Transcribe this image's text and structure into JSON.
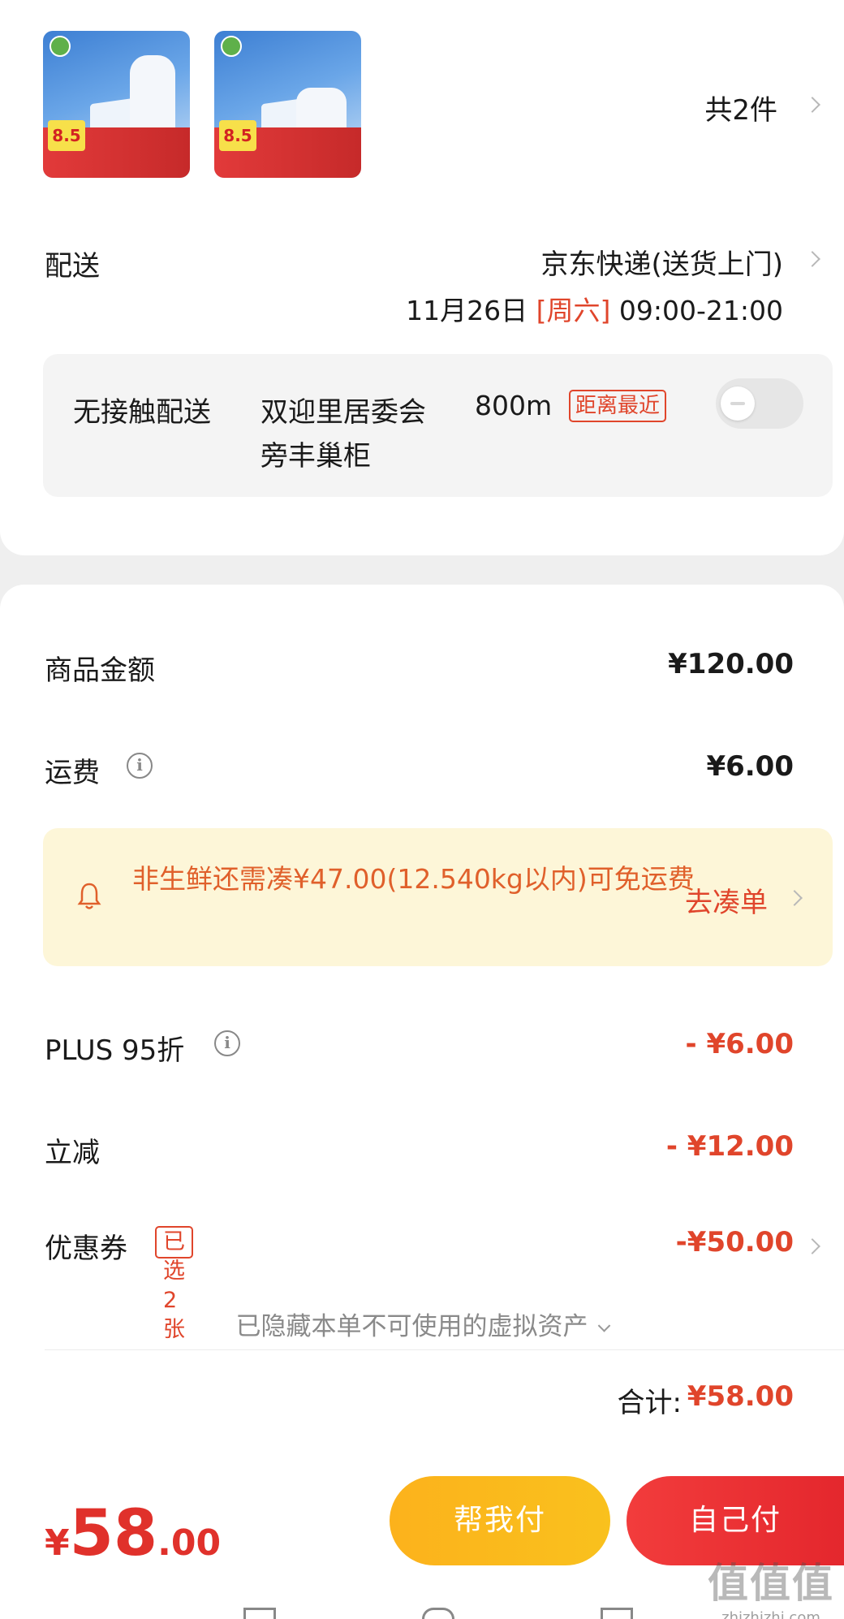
{
  "order": {
    "items_count": "共2件",
    "products": [
      {
        "name": "product-thumbnail-1"
      },
      {
        "name": "product-thumbnail-2"
      }
    ]
  },
  "delivery": {
    "label": "配送",
    "method": "京东快递(送货上门)",
    "date": "11月26日",
    "weekday": "[周六]",
    "time_window": "09:00-21:00"
  },
  "contactless": {
    "title": "无接触配送",
    "place_line1": "双迎里居委会",
    "place_line2": "旁丰巢柜",
    "distance": "800m",
    "tag": "距离最近",
    "toggle_on": false
  },
  "price_breakdown": {
    "goods_label": "商品金额",
    "goods_value": "¥120.00",
    "shipping_label": "运费",
    "shipping_value": "¥6.00",
    "notice_text": "非生鲜还需凑¥47.00(12.540kg以内)可免运费",
    "notice_link": "去凑单",
    "plus_label": "PLUS 95折",
    "plus_value": "- ¥6.00",
    "instant_label": "立减",
    "instant_value": "- ¥12.00",
    "coupon_label": "优惠券",
    "coupon_tag": "已选2张",
    "coupon_value": "-¥50.00",
    "hidden_assets": "已隐藏本单不可使用的虚拟资产",
    "total_label": "合计:",
    "total_value": "¥58.00"
  },
  "bottom_bar": {
    "currency": "¥",
    "price_int": "58",
    "price_dec": ".00",
    "friend_pay": "帮我付",
    "self_pay": "自己付"
  },
  "watermark": {
    "logo": "值值值",
    "url": "zhizhizhi.com"
  },
  "colors": {
    "accent_red": "#e0452b",
    "notice_bg": "#fdf6d8",
    "friend_btn": "#fcb21c",
    "self_btn": "#e4272d"
  },
  "icons": [
    "chevron-right-icon",
    "info-icon",
    "bell-icon",
    "chevron-down-icon",
    "toggle-switch"
  ]
}
